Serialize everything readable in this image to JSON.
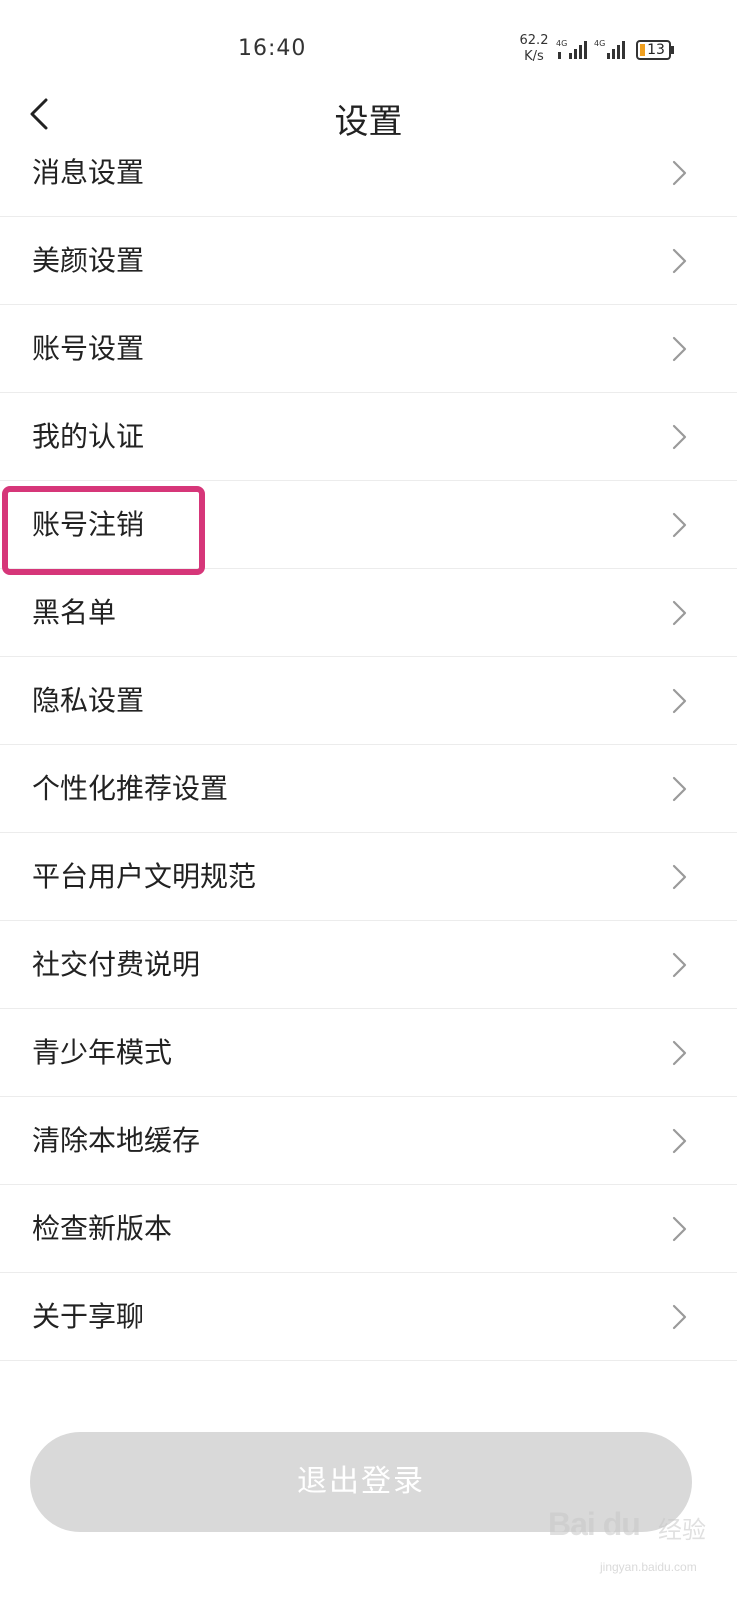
{
  "status_bar": {
    "time": "16:40",
    "net_speed_value": "62.2",
    "net_speed_unit": "K/s",
    "signal_1_label": "4G",
    "signal_2_label": "4G",
    "battery_level": "13"
  },
  "header": {
    "back_icon": "chevron-left-icon",
    "title": "设置"
  },
  "settings": {
    "items": [
      {
        "label": "消息设置"
      },
      {
        "label": "美颜设置"
      },
      {
        "label": "账号设置"
      },
      {
        "label": "我的认证"
      },
      {
        "label": "账号注销"
      },
      {
        "label": "黑名单"
      },
      {
        "label": "隐私设置"
      },
      {
        "label": "个性化推荐设置"
      },
      {
        "label": "平台用户文明规范"
      },
      {
        "label": "社交付费说明"
      },
      {
        "label": "青少年模式"
      },
      {
        "label": "清除本地缓存"
      },
      {
        "label": "检查新版本"
      },
      {
        "label": "关于享聊"
      }
    ],
    "chevron_icon": "chevron-right-icon",
    "highlighted_item": "账号注销"
  },
  "footer": {
    "logout_label": "退出登录"
  },
  "watermark": {
    "logo": "Bai du",
    "text": "经验",
    "sub": "jingyan.baidu.com"
  },
  "colors": {
    "highlight": "#d63679",
    "logout_bg": "#d9d9d9",
    "divider": "#ececec",
    "battery_fill": "#f0a020"
  }
}
